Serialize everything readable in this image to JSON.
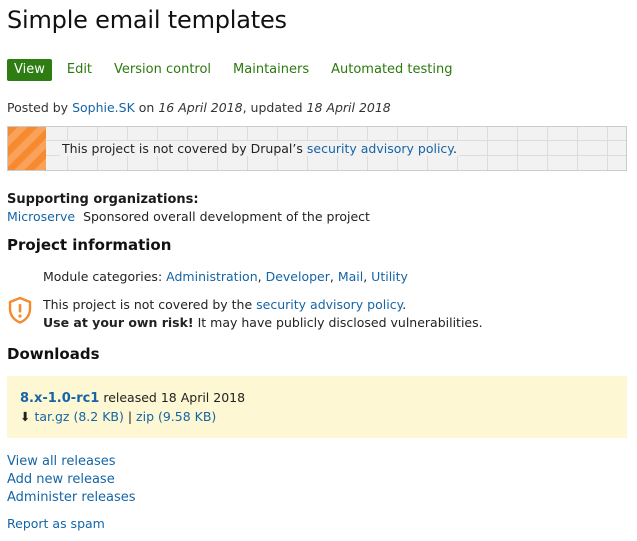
{
  "page": {
    "title": "Simple email templates"
  },
  "tabs": [
    {
      "label": "View",
      "active": true
    },
    {
      "label": "Edit"
    },
    {
      "label": "Version control"
    },
    {
      "label": "Maintainers"
    },
    {
      "label": "Automated testing"
    }
  ],
  "posted": {
    "prefix": "Posted by",
    "author": "Sophie.SK",
    "on": "on",
    "date": "16 April 2018",
    "updated_prefix": ", updated",
    "updated_date": "18 April 2018"
  },
  "notice": {
    "text": "This project is not covered by Drupal’s",
    "link": "security advisory policy",
    "suffix": "."
  },
  "organizations": {
    "heading": "Supporting organizations:",
    "name": "Microserve",
    "description": "Sponsored overall development of the project"
  },
  "project_info": {
    "heading": "Project information",
    "categories_label": "Module categories:",
    "categories": [
      "Administration",
      "Developer",
      "Mail",
      "Utility"
    ],
    "security_text": "This project is not covered by the",
    "security_link": "security advisory policy",
    "security_suffix": ".",
    "risk_bold": "Use at your own risk!",
    "risk_text": "It may have publicly disclosed vulnerabilities."
  },
  "downloads": {
    "heading": "Downloads",
    "version": "8.x-1.0-rc1",
    "released_text": "released 18 April 2018",
    "download_icon": "⬇",
    "tar_label": "tar.gz (8.2 KB)",
    "separator": "|",
    "zip_label": "zip (9.58 KB)"
  },
  "links": {
    "view_all": "View all releases",
    "add_new": "Add new release",
    "administer": "Administer releases",
    "report_spam": "Report as spam"
  },
  "colors": {
    "link": "#1565a6",
    "tab_active_bg": "#2e7d12",
    "tab_text": "#2c7a0e",
    "warning_orange": "#f7892f",
    "release_bg": "#fdf7d4"
  }
}
